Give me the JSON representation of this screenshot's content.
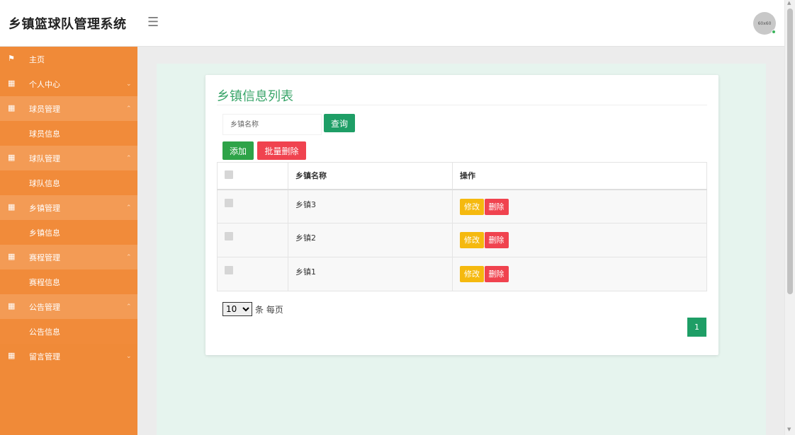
{
  "header": {
    "brand": "乡镇篮球队管理系统",
    "menu_icon": "hamburger-icon",
    "avatar_text": "60x60"
  },
  "sidebar": {
    "items": [
      {
        "label": "主页",
        "type": "parent",
        "icon": "flag-icon"
      },
      {
        "label": "个人中心",
        "type": "parent",
        "icon": "grid-icon",
        "caret": "chevron-down"
      },
      {
        "label": "球员管理",
        "type": "parent",
        "icon": "grid-icon",
        "caret": "chevron-up",
        "open": true
      },
      {
        "label": "球员信息",
        "type": "child"
      },
      {
        "label": "球队管理",
        "type": "parent",
        "icon": "grid-icon",
        "caret": "chevron-up",
        "open": true
      },
      {
        "label": "球队信息",
        "type": "child"
      },
      {
        "label": "乡镇管理",
        "type": "parent",
        "icon": "grid-icon",
        "caret": "chevron-up",
        "open": true
      },
      {
        "label": "乡镇信息",
        "type": "child"
      },
      {
        "label": "赛程管理",
        "type": "parent",
        "icon": "grid-icon",
        "caret": "chevron-up",
        "open": true
      },
      {
        "label": "赛程信息",
        "type": "child"
      },
      {
        "label": "公告管理",
        "type": "parent",
        "icon": "grid-icon",
        "caret": "chevron-up",
        "open": true
      },
      {
        "label": "公告信息",
        "type": "child"
      },
      {
        "label": "留言管理",
        "type": "parent",
        "icon": "grid-icon",
        "caret": "chevron-down"
      }
    ]
  },
  "main": {
    "title": "乡镇信息列表",
    "search": {
      "placeholder": "乡镇名称",
      "button": "查询"
    },
    "actions": {
      "add": "添加",
      "batch_delete": "批量删除"
    },
    "table": {
      "headers": [
        "",
        "乡镇名称",
        "操作"
      ],
      "rows": [
        {
          "name": "乡镇3",
          "edit": "修改",
          "delete": "删除"
        },
        {
          "name": "乡镇2",
          "edit": "修改",
          "delete": "删除"
        },
        {
          "name": "乡镇1",
          "edit": "修改",
          "delete": "删除"
        }
      ]
    },
    "pagination": {
      "page_size": "10",
      "page_size_suffix": "条 每页",
      "current_page": "1"
    }
  },
  "colors": {
    "sidebar": "#f08a38",
    "accent_green": "#1e9e66",
    "danger": "#f0434f",
    "warning": "#f5b90f"
  }
}
